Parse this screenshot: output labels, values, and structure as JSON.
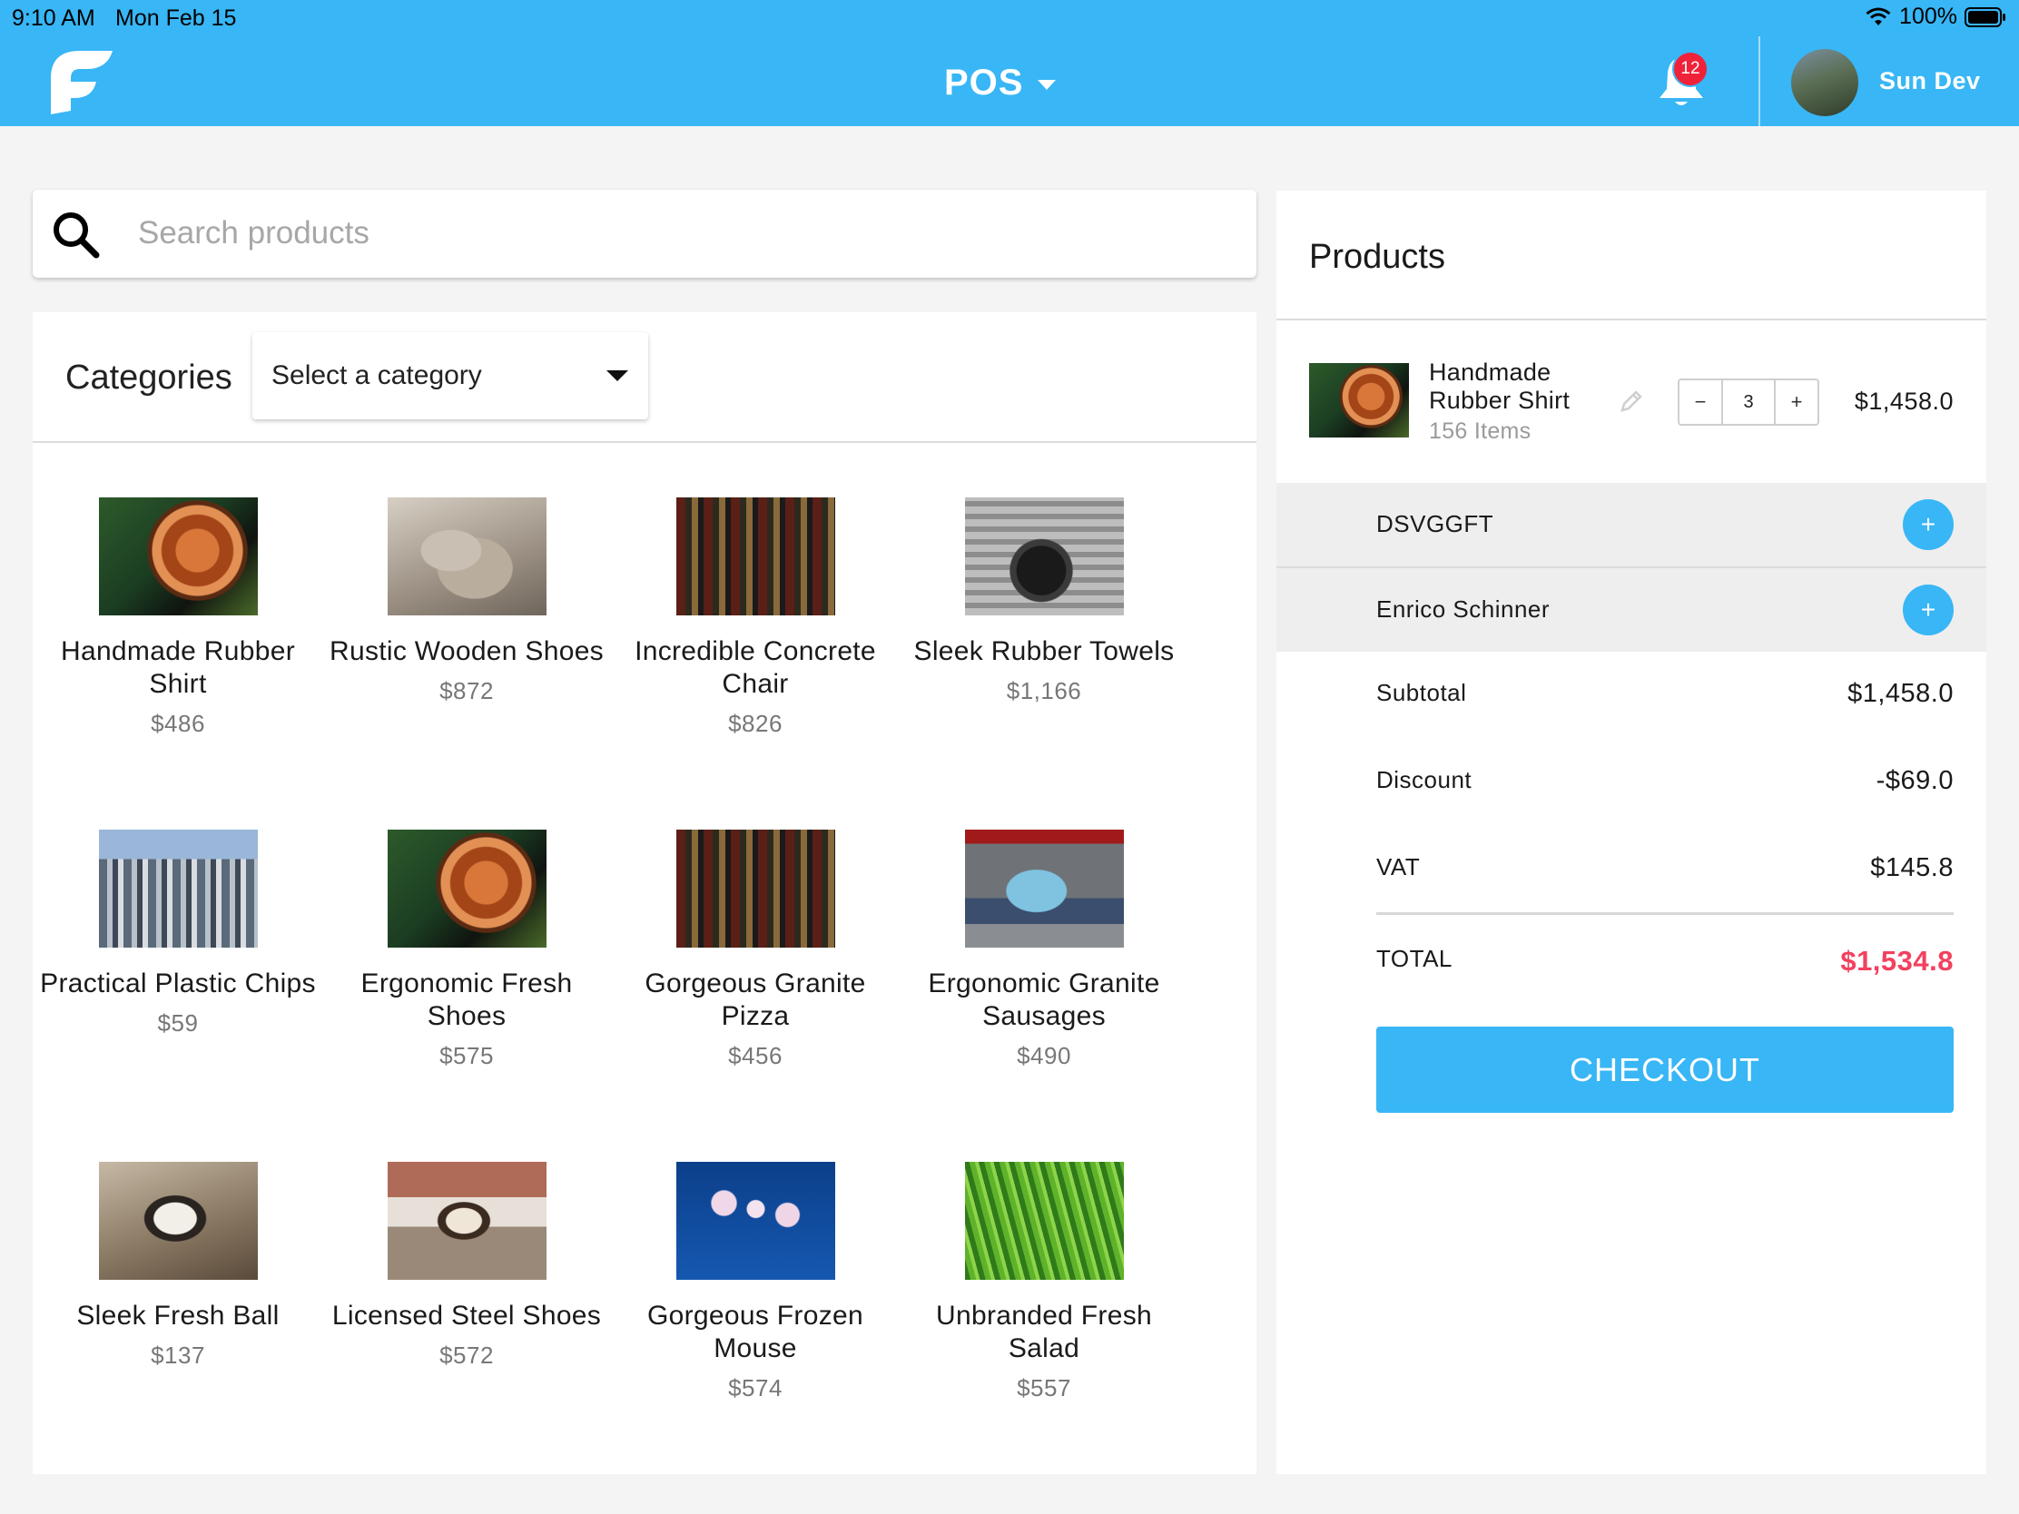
{
  "status_bar": {
    "time": "9:10 AM",
    "date": "Mon Feb 15",
    "battery": "100%"
  },
  "header": {
    "title": "POS",
    "notification_count": "12",
    "user_name": "Sun Dev",
    "accent_color": "#38b6f5"
  },
  "search": {
    "placeholder": "Search products",
    "value": ""
  },
  "categories": {
    "title": "Categories",
    "selected": "Select a category"
  },
  "products": [
    {
      "name": "Handmade Rubber Shirt",
      "price": "$486",
      "image": "copper-coil"
    },
    {
      "name": "Rustic Wooden Shoes",
      "price": "$872",
      "image": "cat"
    },
    {
      "name": "Incredible Concrete Chair",
      "price": "$826",
      "image": "bottles"
    },
    {
      "name": "Sleek Rubber Towels",
      "price": "$1,166",
      "image": "headphones"
    },
    {
      "name": "Practical Plastic Chips",
      "price": "$59",
      "image": "city"
    },
    {
      "name": "Ergonomic Fresh Shoes",
      "price": "$575",
      "image": "copper-coil"
    },
    {
      "name": "Gorgeous Granite Pizza",
      "price": "$456",
      "image": "bottles"
    },
    {
      "name": "Ergonomic Granite Sausages",
      "price": "$490",
      "image": "car"
    },
    {
      "name": "Sleek Fresh Ball",
      "price": "$137",
      "image": "cat"
    },
    {
      "name": "Licensed Steel Shoes",
      "price": "$572",
      "image": "cat"
    },
    {
      "name": "Gorgeous Frozen Mouse",
      "price": "$574",
      "image": "orchid"
    },
    {
      "name": "Unbranded Fresh Salad",
      "price": "$557",
      "image": "grass"
    }
  ],
  "cart": {
    "title": "Products",
    "items": [
      {
        "name": "Handmade Rubber Shirt",
        "stock": "156 Items",
        "quantity": "3",
        "total": "$1,458.0",
        "image": "copper-coil"
      }
    ],
    "options": [
      {
        "label": "DSVGGFT"
      },
      {
        "label": "Enrico Schinner"
      }
    ],
    "summary": {
      "subtotal_label": "Subtotal",
      "subtotal": "$1,458.0",
      "discount_label": "Discount",
      "discount": "-$69.0",
      "vat_label": "VAT",
      "vat": "$145.8",
      "total_label": "TOTAL",
      "total": "$1,534.8",
      "total_color": "#f2415e"
    },
    "checkout_label": "CHECKOUT"
  }
}
